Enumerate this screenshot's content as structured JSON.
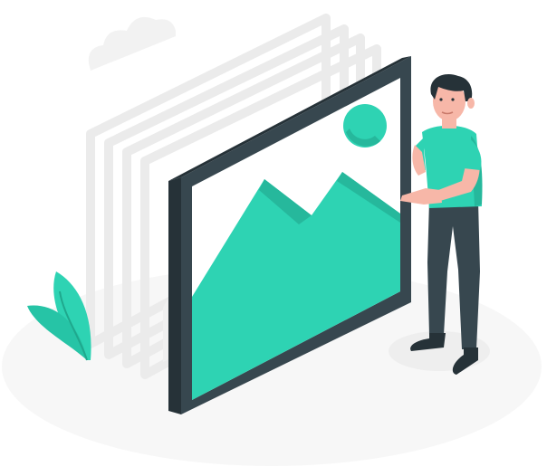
{
  "scene": {
    "subject": "illustration",
    "colors": {
      "accent": "#2ed3b3",
      "accent_dark": "#26b89c",
      "frame": "#37474f",
      "frame_side": "#263238",
      "skin": "#f7b7a8",
      "hair": "#263238",
      "ghost": "#f1f1f1",
      "ghost_line": "#e6e6e6",
      "ground": "#f5f5f5"
    },
    "icons": [
      "cloud-icon",
      "leaf-icon",
      "mountain-icon",
      "sun-icon"
    ]
  }
}
